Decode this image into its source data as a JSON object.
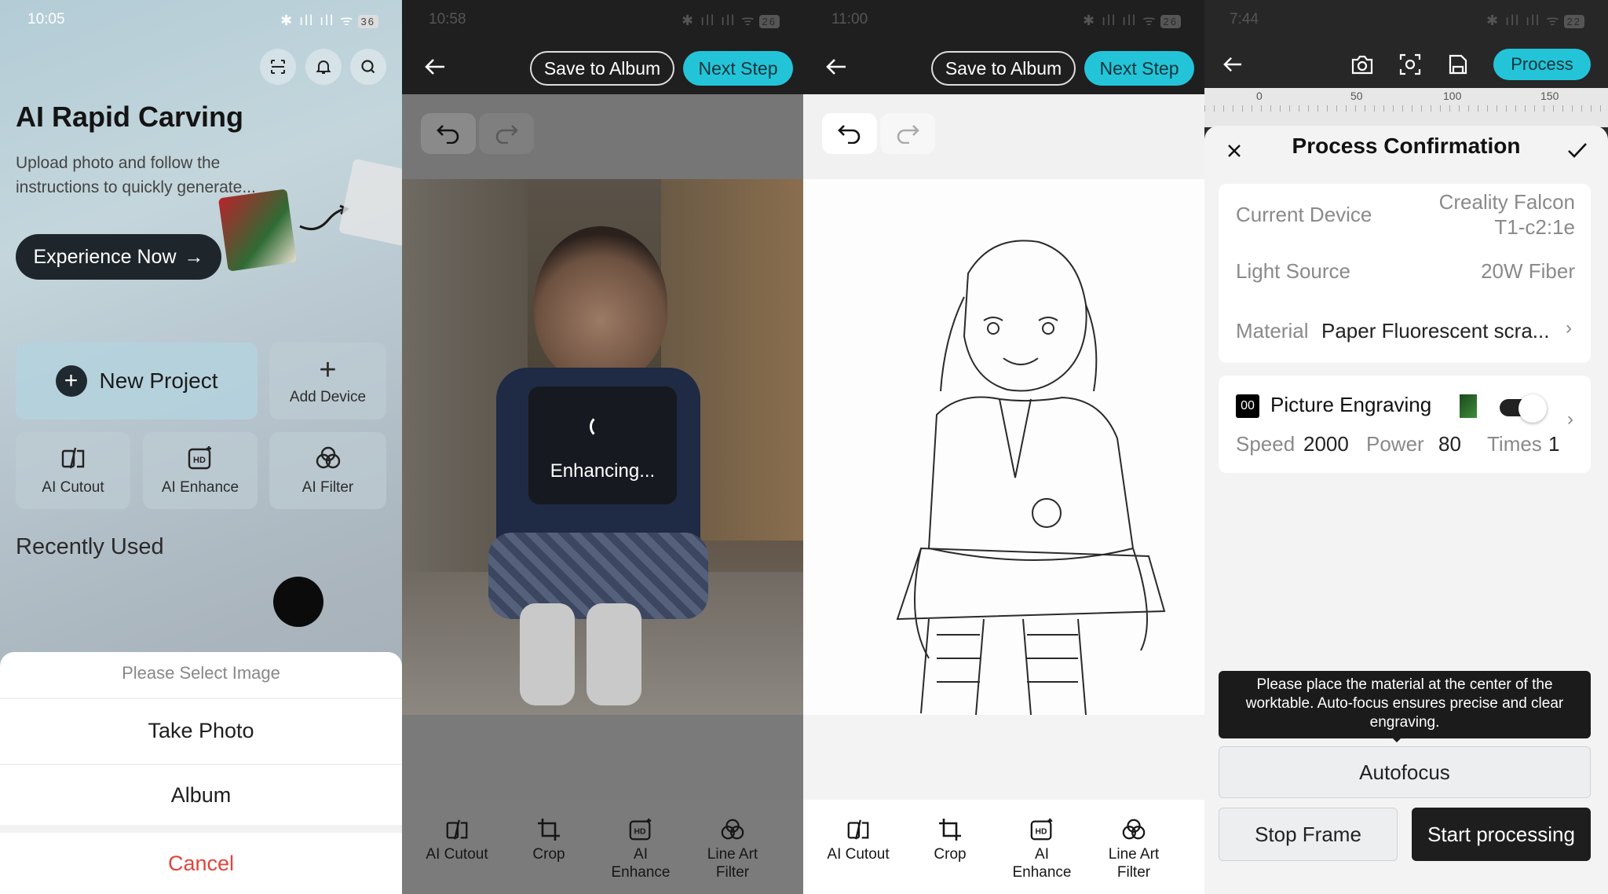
{
  "panel1": {
    "status_time": "10:05",
    "battery": "36",
    "title": "AI Rapid Carving",
    "subtitle_line1": "Upload photo and follow the",
    "subtitle_line2": "instructions to quickly generate...",
    "experience_button": "Experience Now",
    "new_project": "New Project",
    "add_device": "Add Device",
    "tools": [
      "AI Cutout",
      "AI Enhance",
      "AI Filter"
    ],
    "recently_used": "Recently Used",
    "sheet": {
      "title": "Please Select Image",
      "take_photo": "Take Photo",
      "album": "Album",
      "cancel": "Cancel"
    }
  },
  "panel2": {
    "status_time": "10:58",
    "battery": "26",
    "save_album": "Save to Album",
    "next_step": "Next Step",
    "enhancing": "Enhancing...",
    "tools": [
      {
        "line1": "AI Cutout",
        "line2": ""
      },
      {
        "line1": "Crop",
        "line2": ""
      },
      {
        "line1": "AI",
        "line2": "Enhance"
      },
      {
        "line1": "Line Art",
        "line2": "Filter"
      }
    ]
  },
  "panel3": {
    "status_time": "11:00",
    "battery": "26",
    "save_album": "Save to Album",
    "next_step": "Next Step",
    "tools": [
      {
        "line1": "AI Cutout",
        "line2": ""
      },
      {
        "line1": "Crop",
        "line2": ""
      },
      {
        "line1": "AI",
        "line2": "Enhance"
      },
      {
        "line1": "Line Art",
        "line2": "Filter"
      }
    ]
  },
  "panel4": {
    "status_time": "7:44",
    "battery": "22",
    "process_button": "Process",
    "ruler_labels": [
      "0",
      "50",
      "100",
      "150"
    ],
    "sheet_title": "Process Confirmation",
    "current_device_label": "Current Device",
    "current_device_value_1": "Creality Falcon",
    "current_device_value_2": "T1-c2:1e",
    "light_source_label": "Light Source",
    "light_source_value": "20W Fiber",
    "material_label": "Material",
    "material_value": "Paper Fluorescent scra...",
    "layer_badge": "00",
    "layer_name": "Picture Engraving",
    "speed_label": "Speed",
    "speed_value": "2000",
    "power_label": "Power",
    "power_value": "80",
    "times_label": "Times",
    "times_value": "1",
    "tooltip": "Please place the material at the center of the worktable. Auto-focus ensures precise and clear engraving.",
    "autofocus": "Autofocus",
    "stop_frame": "Stop Frame",
    "start_processing": "Start processing"
  },
  "colors": {
    "accent_cyan": "#24c4d8",
    "cancel_red": "#e0443b",
    "dark": "#1e262c"
  }
}
